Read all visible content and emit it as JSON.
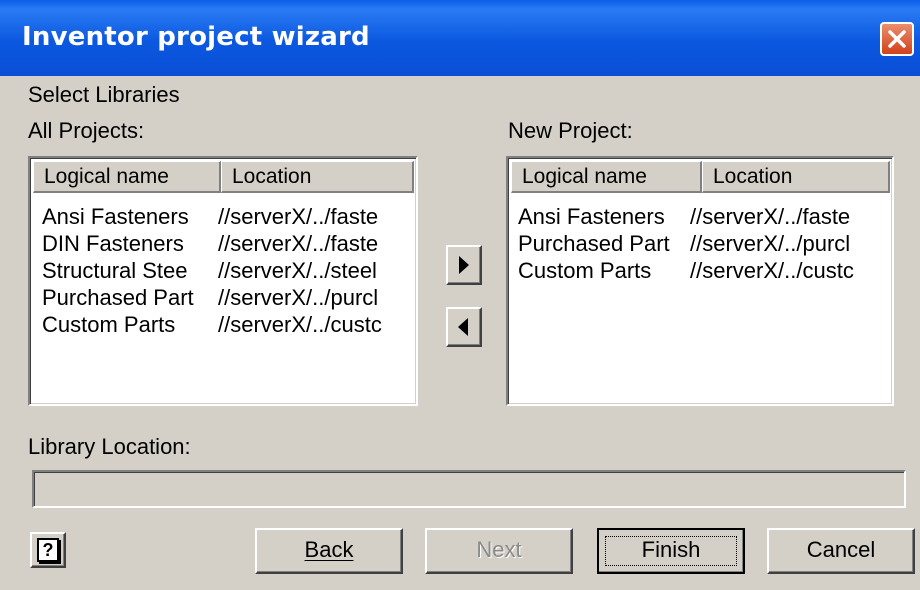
{
  "window": {
    "title": "Inventor project wizard"
  },
  "section": {
    "heading": "Select Libraries"
  },
  "all_projects": {
    "label": "All Projects:",
    "columns": [
      "Logical name",
      "Location"
    ],
    "rows": [
      {
        "name": "Ansi Fasteners",
        "location": "//serverX/../faste"
      },
      {
        "name": "DIN Fasteners",
        "location": "//serverX/../faste"
      },
      {
        "name": "Structural Stee",
        "location": "//serverX/../steel"
      },
      {
        "name": "Purchased Part",
        "location": "//serverX/../purcl"
      },
      {
        "name": "Custom Parts",
        "location": "//serverX/../custc"
      }
    ]
  },
  "new_project": {
    "label": "New Project:",
    "columns": [
      "Logical name",
      "Location"
    ],
    "rows": [
      {
        "name": "Ansi Fasteners",
        "location": "//serverX/../faste"
      },
      {
        "name": "Purchased Part",
        "location": "//serverX/../purcl"
      },
      {
        "name": "Custom Parts",
        "location": "//serverX/../custc"
      }
    ]
  },
  "library_location": {
    "label": "Library Location:",
    "value": ""
  },
  "buttons": {
    "help": "?",
    "back": "Back",
    "next": "Next",
    "finish": "Finish",
    "cancel": "Cancel"
  }
}
